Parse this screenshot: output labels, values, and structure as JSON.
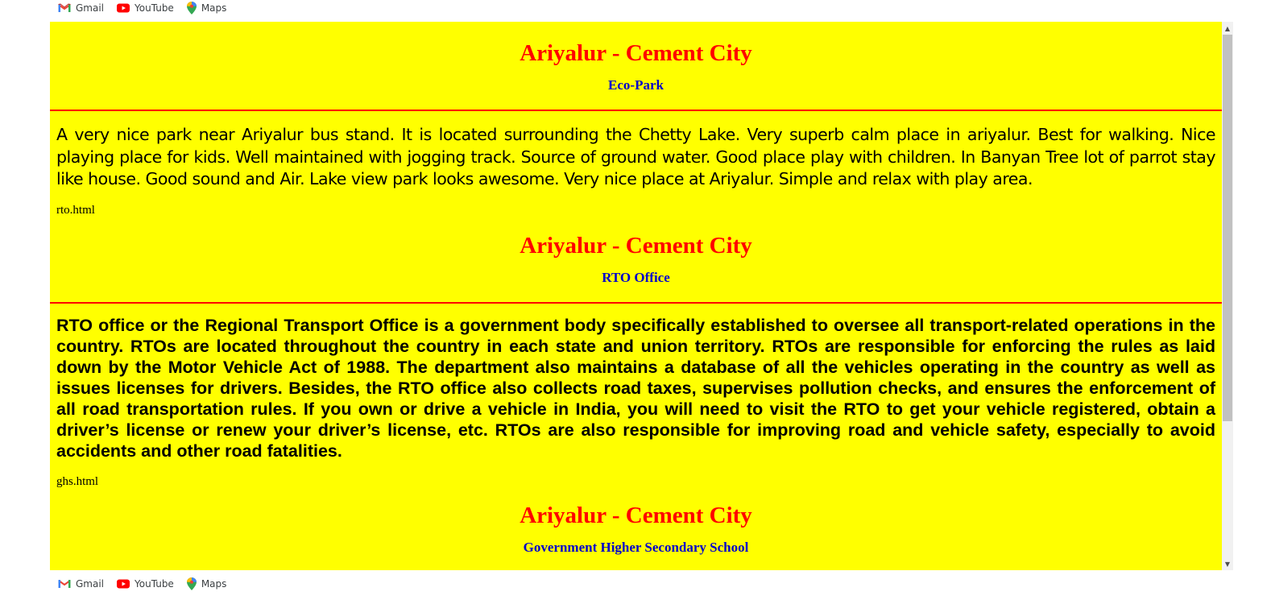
{
  "bookmarks": [
    {
      "label": "Gmail",
      "icon": "gmail-icon"
    },
    {
      "label": "YouTube",
      "icon": "youtube-icon"
    },
    {
      "label": "Maps",
      "icon": "maps-icon"
    }
  ],
  "colors": {
    "page_bg": "#ffff00",
    "heading": "#ff0000",
    "subheading": "#0000cc",
    "rule": "#ff0000"
  },
  "sections": [
    {
      "title": "Ariyalur - Cement City",
      "subtitle": "Eco-Park",
      "body": "A very nice park near Ariyalur bus stand. It is located surrounding the Chetty Lake. Very superb calm place in ariyalur. Best for walking. Nice playing place for kids. Well maintained with jogging track. Source of ground water. Good place play with children. In Banyan Tree lot of parrot stay like house. Good sound and Air. Lake view park looks awesome. Very nice place at Ariyalur. Simple and relax with play area.",
      "link": "rto.html"
    },
    {
      "title": "Ariyalur - Cement City",
      "subtitle": "RTO Office",
      "body": "RTO office or the Regional Transport Office is a government body specifically established to oversee all transport-related operations in the country. RTOs are located throughout the country in each state and union territory. RTOs are responsible for enforcing the rules as laid down by the Motor Vehicle Act of 1988. The department also maintains a database of all the vehicles operating in the country as well as issues licenses for drivers. Besides, the RTO office also collects road taxes, supervises pollution checks, and ensures the enforcement of all road transportation rules. If you own or drive a vehicle in India, you will need to visit the RTO to get your vehicle registered, obtain a driver’s license or renew your driver’s license, etc. RTOs are also responsible for improving road and vehicle safety, especially to avoid accidents and other road fatalities.",
      "link": "ghs.html"
    },
    {
      "title": "Ariyalur - Cement City",
      "subtitle": "Government Higher Secondary School"
    }
  ]
}
